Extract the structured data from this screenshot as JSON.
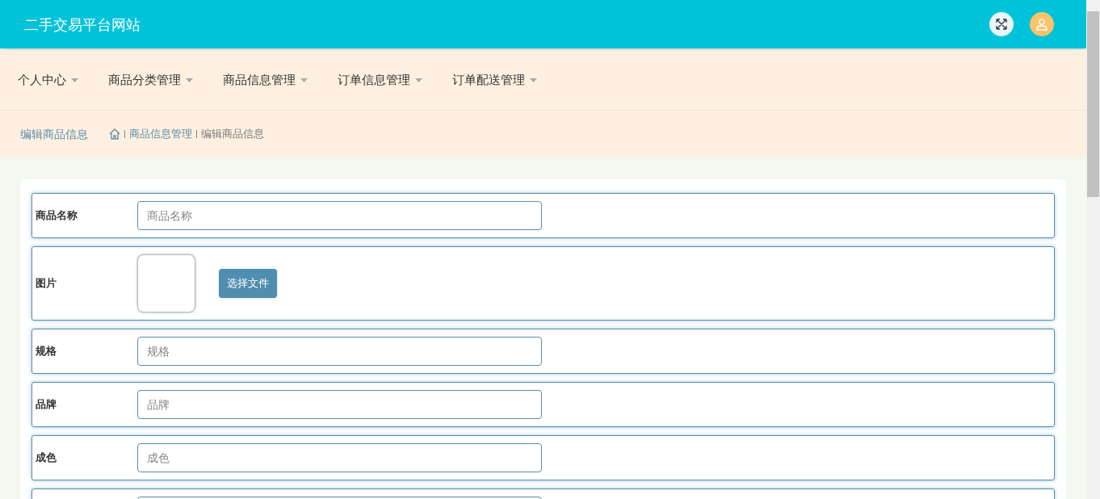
{
  "header": {
    "title": "二手交易平台网站"
  },
  "nav": [
    {
      "label": "个人中心"
    },
    {
      "label": "商品分类管理"
    },
    {
      "label": "商品信息管理"
    },
    {
      "label": "订单信息管理"
    },
    {
      "label": "订单配送管理"
    }
  ],
  "breadcrumb": {
    "title": "编辑商品信息",
    "path": [
      "商品信息管理",
      "编辑商品信息"
    ]
  },
  "form": {
    "rows": [
      {
        "kind": "text",
        "label": "商品名称",
        "placeholder": "商品名称"
      },
      {
        "kind": "image",
        "label": "图片",
        "button": "选择文件"
      },
      {
        "kind": "text",
        "label": "规格",
        "placeholder": "规格"
      },
      {
        "kind": "text",
        "label": "品牌",
        "placeholder": "品牌"
      },
      {
        "kind": "text",
        "label": "成色",
        "placeholder": "成色"
      },
      {
        "kind": "text"
      }
    ]
  }
}
